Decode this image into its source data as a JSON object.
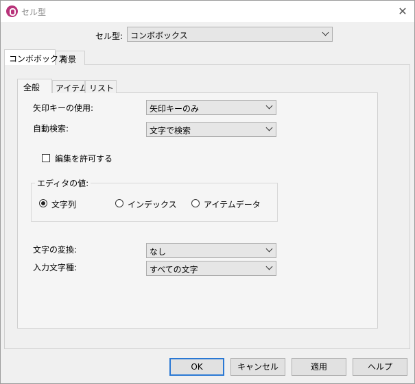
{
  "window": {
    "title": "セル型"
  },
  "cell_type": {
    "label": "セル型:",
    "value": "コンボボックス"
  },
  "outer_tabs": [
    {
      "label": "コンボボックス",
      "active": true
    },
    {
      "label": "背景",
      "active": false
    }
  ],
  "inner_tabs": [
    {
      "label": "全般",
      "active": true
    },
    {
      "label": "アイテム",
      "active": false
    },
    {
      "label": "リスト",
      "active": false
    }
  ],
  "general": {
    "arrow_key_label": "矢印キーの使用:",
    "arrow_key_value": "矢印キーのみ",
    "auto_search_label": "自動検索:",
    "auto_search_value": "文字で検索",
    "allow_edit_label": "編集を許可する",
    "allow_edit_checked": false,
    "editor_value_group": "エディタの値:",
    "editor_value_options": [
      {
        "label": "文字列",
        "selected": true
      },
      {
        "label": "インデックス",
        "selected": false
      },
      {
        "label": "アイテムデータ",
        "selected": false
      }
    ],
    "char_conversion_label": "文字の変換:",
    "char_conversion_value": "なし",
    "input_char_type_label": "入力文字種:",
    "input_char_type_value": "すべての文字"
  },
  "buttons": {
    "ok": "OK",
    "cancel": "キャンセル",
    "apply": "適用",
    "help": "ヘルプ"
  },
  "icons": {
    "app": "app-logo-icon",
    "close": "close-icon",
    "dropdown": "chevron-down-icon"
  },
  "colors": {
    "accent": "#2a78d4",
    "app_icon": "#b8337a"
  }
}
